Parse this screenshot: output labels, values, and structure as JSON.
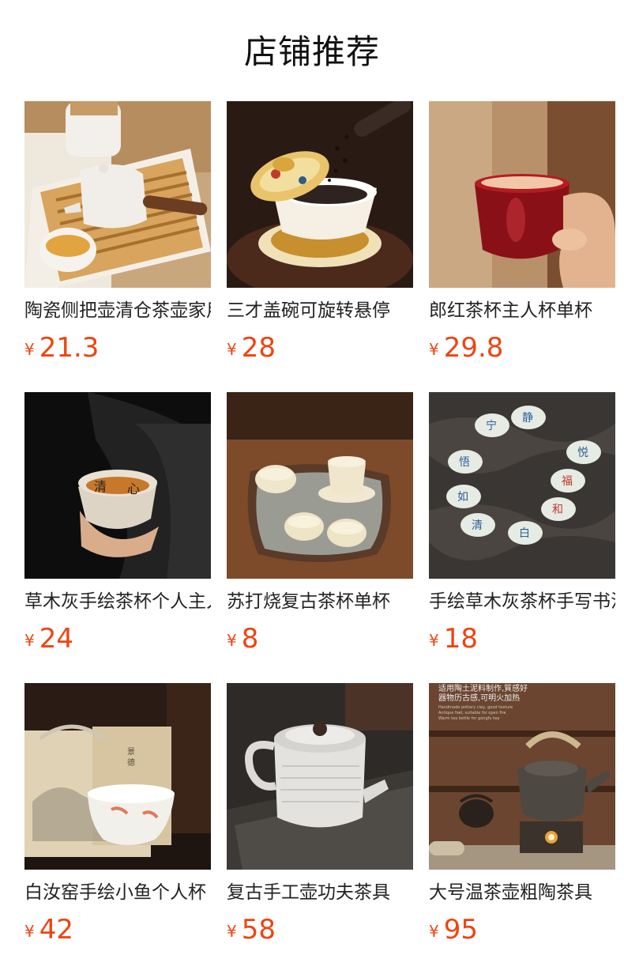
{
  "page_title": "店铺推荐",
  "currency_symbol": "¥",
  "products": [
    {
      "name": "陶瓷侧把壶清仓茶壶家用",
      "price": "21.3",
      "image": "side-handle-teapot-photo"
    },
    {
      "name": "三才盖碗可旋转悬停",
      "price": "28",
      "image": "gaiwan-photo"
    },
    {
      "name": "郎红茶杯主人杯单杯",
      "price": "29.8",
      "image": "red-teacup-photo"
    },
    {
      "name": "草木灰手绘茶杯个人主人杯",
      "price": "24",
      "image": "handpainted-cup-photo"
    },
    {
      "name": "苏打烧复古茶杯单杯",
      "price": "8",
      "image": "tea-set-tray-photo"
    },
    {
      "name": "手绘草木灰茶杯手写书法",
      "price": "18",
      "image": "calligraphy-cups-photo"
    },
    {
      "name": "白汝窑手绘小鱼个人杯",
      "price": "42",
      "image": "fish-cup-photo"
    },
    {
      "name": "复古手工壶功夫茶具",
      "price": "58",
      "image": "white-teapot-photo"
    },
    {
      "name": "大号温茶壶粗陶茶具",
      "price": "95",
      "image": "warming-kettle-photo"
    }
  ]
}
